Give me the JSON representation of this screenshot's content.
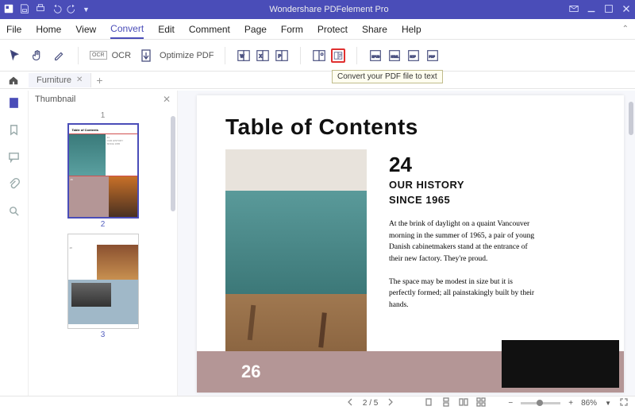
{
  "titlebar": {
    "app_title": "Wondershare PDFelement Pro"
  },
  "menu": {
    "file": "File",
    "home": "Home",
    "view": "View",
    "convert": "Convert",
    "edit": "Edit",
    "comment": "Comment",
    "page": "Page",
    "form": "Form",
    "protect": "Protect",
    "share": "Share",
    "help": "Help"
  },
  "toolbar": {
    "ocr": "OCR",
    "optimize": "Optimize PDF"
  },
  "tooltip": "Convert your PDF file to text",
  "tab": {
    "name": "Furniture"
  },
  "sidebar": {
    "title": "Thumbnail",
    "n1": "1",
    "n2": "2",
    "n3": "3"
  },
  "content": {
    "title": "Table of Contents",
    "big": "24",
    "sub1": "OUR HISTORY",
    "sub2": "SINCE 1965",
    "p1": "At the brink of daylight on a quaint Vancouver morning in the summer of 1965, a pair of young Danish cabinetmakers stand at the entrance of their new factory. They're proud.",
    "p2": "The space may be modest in size but it is perfectly formed; all painstakingly built by their hands.",
    "stripe": "26"
  },
  "status": {
    "page": "2 / 5",
    "zoom": "86%"
  }
}
